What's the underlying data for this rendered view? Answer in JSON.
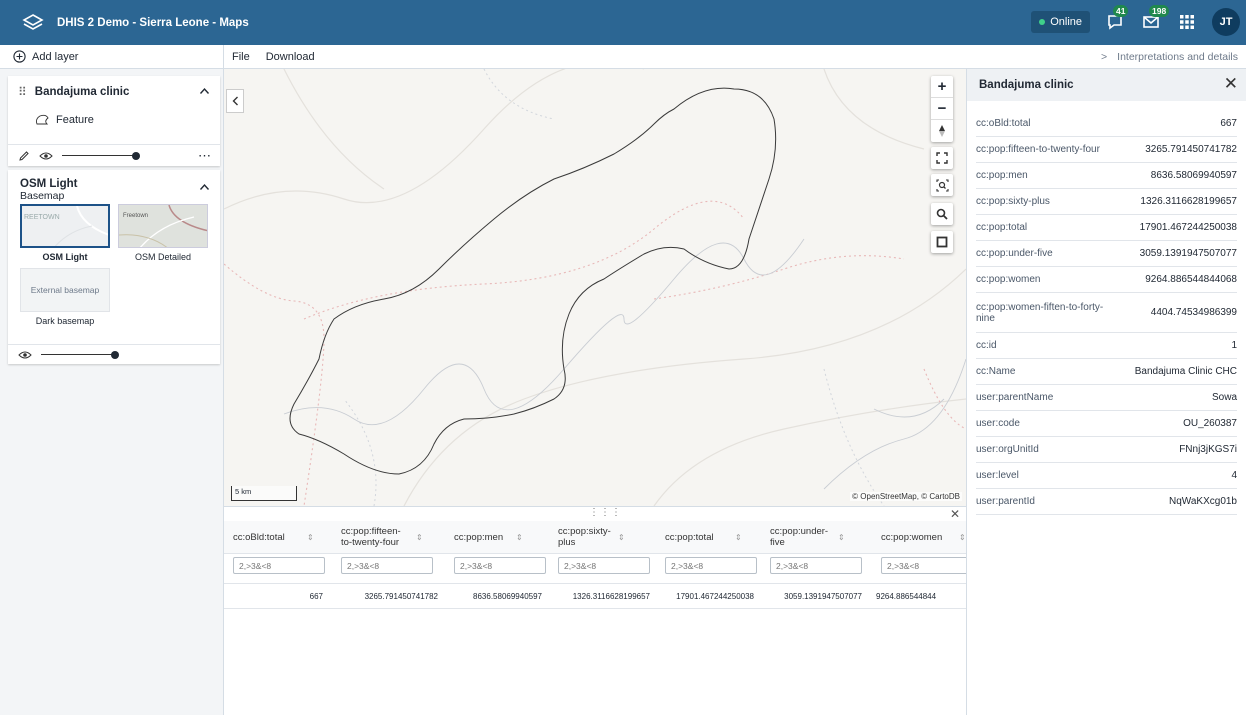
{
  "header": {
    "title": "DHIS 2 Demo - Sierra Leone - Maps",
    "status": "Online",
    "interpretations_badge": "41",
    "messages_badge": "198",
    "avatar_initials": "JT",
    "colors": {
      "bar": "#2c6693",
      "online_dot": "#3fd08a",
      "badge": "#20884d"
    },
    "icons": [
      "dhis2-logo-icon",
      "interpretations-icon",
      "messages-icon",
      "apps-grid-icon"
    ]
  },
  "left_panel": {
    "add_layer_label": "Add layer",
    "feature_layer": {
      "title": "Bandajuma clinic",
      "legend_label": "Feature"
    },
    "basemap_card": {
      "title": "OSM Light",
      "subtitle": "Basemap",
      "basemaps": [
        {
          "label": "OSM Light",
          "selected": true,
          "thumb_text": "REETOWN"
        },
        {
          "label": "OSM Detailed",
          "selected": false,
          "thumb_text": "Freetown"
        },
        {
          "label": "Dark basemap",
          "selected": false,
          "thumb_text": "External basemap"
        }
      ]
    }
  },
  "menubar": {
    "file": "File",
    "download": "Download",
    "interpretations": "Interpretations and details"
  },
  "map": {
    "scale_label": "5 km",
    "attribution": "© OpenStreetMap, © CartoDB",
    "zoom_in": "+",
    "zoom_out": "−"
  },
  "data_table": {
    "columns": [
      "cc:oBld:total",
      "cc:pop:fifteen-to-twenty-four",
      "cc:pop:men",
      "cc:pop:sixty-plus",
      "cc:pop:total",
      "cc:pop:under-five",
      "cc:pop:women"
    ],
    "filter_placeholder": "2,>3&<8",
    "rows": [
      [
        "667",
        "3265.791450741782",
        "8636.58069940597",
        "1326.3116628199657",
        "17901.467244250038",
        "3059.1391947507077",
        "9264.886544844"
      ]
    ]
  },
  "details_panel": {
    "title": "Bandajuma clinic",
    "rows": [
      {
        "key": "cc:oBld:total",
        "value": "667"
      },
      {
        "key": "cc:pop:fifteen-to-twenty-four",
        "value": "3265.791450741782"
      },
      {
        "key": "cc:pop:men",
        "value": "8636.58069940597"
      },
      {
        "key": "cc:pop:sixty-plus",
        "value": "1326.3116628199657"
      },
      {
        "key": "cc:pop:total",
        "value": "17901.467244250038"
      },
      {
        "key": "cc:pop:under-five",
        "value": "3059.1391947507077"
      },
      {
        "key": "cc:pop:women",
        "value": "9264.886544844068"
      },
      {
        "key": "cc:pop:women-fiften-to-forty-nine",
        "value": "4404.74534986399"
      },
      {
        "key": "cc:id",
        "value": "1"
      },
      {
        "key": "cc:Name",
        "value": "Bandajuma Clinic CHC"
      },
      {
        "key": "user:parentName",
        "value": "Sowa"
      },
      {
        "key": "user:code",
        "value": "OU_260387"
      },
      {
        "key": "user:orgUnitId",
        "value": "FNnj3jKGS7i"
      },
      {
        "key": "user:level",
        "value": "4"
      },
      {
        "key": "user:parentId",
        "value": "NqWaKXcg01b"
      }
    ]
  }
}
